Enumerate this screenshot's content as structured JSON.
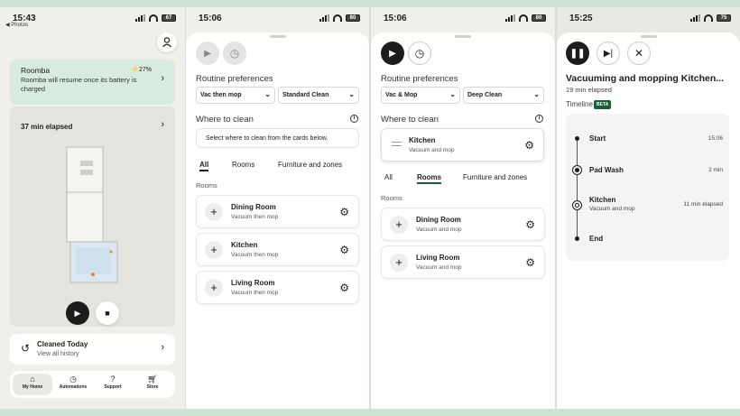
{
  "screen1": {
    "time": "15:43",
    "back": "◀ Photos",
    "battery_text": "67",
    "roomba": {
      "title": "Roomba",
      "battery": "27%",
      "message": "Roomba will resume once its battery is charged"
    },
    "elapsed": "37 min elapsed",
    "cleaned": {
      "title": "Cleaned Today",
      "sub": "View all history"
    },
    "nav": [
      {
        "label": "My Home",
        "icon": "home-icon"
      },
      {
        "label": "Automations",
        "icon": "clock-icon"
      },
      {
        "label": "Support",
        "icon": "support-icon"
      },
      {
        "label": "Store",
        "icon": "cart-icon"
      }
    ]
  },
  "screen2": {
    "time": "15:06",
    "battery_text": "80",
    "routine_label": "Routine preferences",
    "select1": "Vac then mop",
    "select2": "Standard Clean",
    "where_label": "Where to clean",
    "prompt": "Select where to clean from the cards below.",
    "tabs": [
      "All",
      "Rooms",
      "Furniture and zones"
    ],
    "rooms_header": "Rooms",
    "rooms": [
      {
        "name": "Dining Room",
        "sub": "Vacuum then mop"
      },
      {
        "name": "Kitchen",
        "sub": "Vacuum then mop"
      },
      {
        "name": "Living Room",
        "sub": "Vacuum then mop"
      }
    ]
  },
  "screen3": {
    "time": "15:06",
    "battery_text": "80",
    "routine_label": "Routine preferences",
    "select1": "Vac & Mop",
    "select2": "Deep Clean",
    "where_label": "Where to clean",
    "selected": {
      "name": "Kitchen",
      "sub": "Vacuum and mop"
    },
    "tabs": [
      "All",
      "Rooms",
      "Furniture and zones"
    ],
    "rooms_header": "Rooms",
    "rooms": [
      {
        "name": "Dining Room",
        "sub": "Vacuum and mop"
      },
      {
        "name": "Living Room",
        "sub": "Vacuum and mop"
      }
    ]
  },
  "screen4": {
    "time": "15:25",
    "battery_text": "75",
    "title": "Vacuuming and mopping Kitchen...",
    "elapsed": "19 min elapsed",
    "timeline_label": "Timeline",
    "beta": "BETA",
    "events": [
      {
        "name": "Start",
        "sub": "",
        "time": "15:06"
      },
      {
        "name": "Pad Wash",
        "sub": "",
        "time": "2 min"
      },
      {
        "name": "Kitchen",
        "sub": "Vacuum and mop",
        "time": "11 min elapsed"
      },
      {
        "name": "End",
        "sub": "",
        "time": ""
      }
    ]
  },
  "colors": {
    "accent_green": "#1f5c3a",
    "card_green": "#d8ebde",
    "dark": "#1d1d1d"
  }
}
